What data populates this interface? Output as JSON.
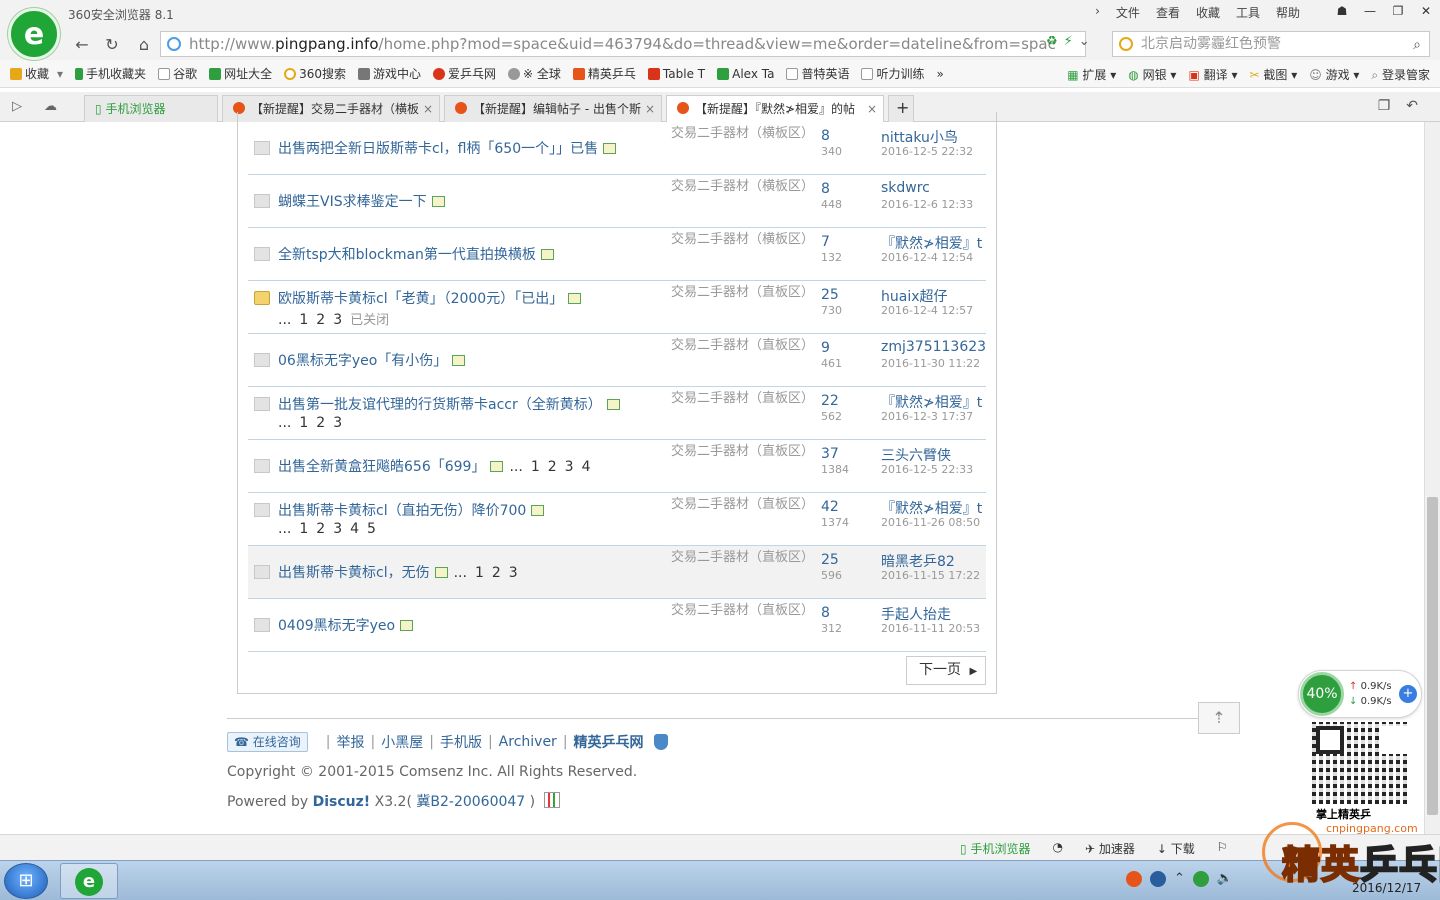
{
  "window": {
    "app_title": "360安全浏览器 8.1",
    "menu": [
      "文件",
      "查看",
      "收藏",
      "工具",
      "帮助"
    ],
    "controls": [
      "☗",
      "—",
      "❐",
      "✕"
    ]
  },
  "address_bar": {
    "url_prefix": "http://www.",
    "url_host": "pingpang.info",
    "url_rest": "/home.php?mod=space&uid=463794&do=thread&view=me&order=dateline&from=spac",
    "search_placeholder": "北京启动雾霾红色预警"
  },
  "favorites_bar": {
    "items": [
      {
        "label": "收藏",
        "color": "#e6a817"
      },
      {
        "label": "手机收藏夹",
        "color": "#2e9e3e"
      },
      {
        "label": "谷歌",
        "color": "#cccccc"
      },
      {
        "label": "网址大全",
        "color": "#2e9e3e"
      },
      {
        "label": "360搜索",
        "color": "#e6a817"
      },
      {
        "label": "游戏中心",
        "color": "#777777"
      },
      {
        "label": "爱乒乓网",
        "color": "#d9341a"
      },
      {
        "label": "※ 全球",
        "color": "#999999"
      },
      {
        "label": "精英乒乓",
        "color": "#e6541a"
      },
      {
        "label": "Table T",
        "color": "#d9341a"
      },
      {
        "label": "Alex Ta",
        "color": "#2e9e3e"
      },
      {
        "label": "普特英语",
        "color": "#cccccc"
      },
      {
        "label": "听力训练",
        "color": "#cccccc"
      }
    ],
    "right_items": [
      "扩展",
      "网银",
      "翻译",
      "截图",
      "游戏",
      "登录管家"
    ]
  },
  "tabs": [
    {
      "label": "手机浏览器",
      "active": false
    },
    {
      "label": "【新提醒】交易二手器材（横板",
      "active": false
    },
    {
      "label": "【新提醒】编辑帖子 - 出售个斯",
      "active": false
    },
    {
      "label": "【新提醒】『默然≯相爱』的帖",
      "active": true
    }
  ],
  "threads": [
    {
      "title": "出售两把全新日版斯蒂卡cl，fl柄「650一个」」已售",
      "pages": [],
      "inline_pages": [],
      "closed": "",
      "forum": "交易二手器材（横板区）",
      "replies": "8",
      "views": "340",
      "author": "nittaku小鸟",
      "date": "2016-12-5 22:32",
      "locked": false,
      "highlight": false
    },
    {
      "title": "蝴蝶王VIS求棒鉴定一下",
      "pages": [],
      "inline_pages": [],
      "closed": "",
      "forum": "交易二手器材（横板区）",
      "replies": "8",
      "views": "448",
      "author": "skdwrc",
      "date": "2016-12-6 12:33",
      "locked": false,
      "highlight": false
    },
    {
      "title": "全新tsp大和blockman第一代直拍换横板",
      "pages": [],
      "inline_pages": [],
      "closed": "",
      "forum": "交易二手器材（横板区）",
      "replies": "7",
      "views": "132",
      "author": "『默然≯相爱』t",
      "date": "2016-12-4 12:54",
      "locked": false,
      "highlight": false
    },
    {
      "title": "欧版斯蒂卡黄标cl「老黄」（2000元）「已出」",
      "pages": [
        "...",
        "1",
        "2",
        "3"
      ],
      "inline_pages": [],
      "closed": "已关闭",
      "forum": "交易二手器材（直板区）",
      "replies": "25",
      "views": "730",
      "author": "huaix超仔",
      "date": "2016-12-4 12:57",
      "locked": true,
      "highlight": false
    },
    {
      "title": "06黑标无字yeo「有小伤」",
      "pages": [],
      "inline_pages": [],
      "closed": "",
      "forum": "交易二手器材（直板区）",
      "replies": "9",
      "views": "461",
      "author": "zmj375113623",
      "date": "2016-11-30 11:22",
      "locked": false,
      "highlight": false
    },
    {
      "title": "出售第一批友谊代理的行货斯蒂卡accr（全新黄标）",
      "pages": [
        "...",
        "1",
        "2",
        "3"
      ],
      "inline_pages": [],
      "closed": "",
      "forum": "交易二手器材（直板区）",
      "replies": "22",
      "views": "562",
      "author": "『默然≯相爱』t",
      "date": "2016-12-3 17:37",
      "locked": false,
      "highlight": false
    },
    {
      "title": "出售全新黄盒狂飚皓656「699」",
      "pages": [],
      "inline_pages": [
        "...",
        "1",
        "2",
        "3",
        "4"
      ],
      "closed": "",
      "forum": "交易二手器材（直板区）",
      "replies": "37",
      "views": "1384",
      "author": "三头六臂侠",
      "date": "2016-12-5 22:33",
      "locked": false,
      "highlight": false
    },
    {
      "title": "出售斯蒂卡黄标cl（直拍无伤）降价700",
      "pages": [
        "...",
        "1",
        "2",
        "3",
        "4",
        "5"
      ],
      "inline_pages": [],
      "closed": "",
      "forum": "交易二手器材（直板区）",
      "replies": "42",
      "views": "1374",
      "author": "『默然≯相爱』t",
      "date": "2016-11-26 08:50",
      "locked": false,
      "highlight": false
    },
    {
      "title": "出售斯蒂卡黄标cl，无伤",
      "pages": [],
      "inline_pages": [
        "...",
        "1",
        "2",
        "3"
      ],
      "closed": "",
      "forum": "交易二手器材（直板区）",
      "replies": "25",
      "views": "596",
      "author": "暗黑老乒82",
      "date": "2016-11-15 17:22",
      "locked": false,
      "highlight": true
    },
    {
      "title": "0409黑标无字yeo",
      "pages": [],
      "inline_pages": [],
      "closed": "",
      "forum": "交易二手器材（直板区）",
      "replies": "8",
      "views": "312",
      "author": "手起人抬走",
      "date": "2016-11-11 20:53",
      "locked": false,
      "highlight": false
    }
  ],
  "pagination": {
    "next_label": "下一页"
  },
  "footer": {
    "consult_label": "在线咨询",
    "links": [
      "举报",
      "小黑屋",
      "手机版",
      "Archiver"
    ],
    "site_name": "精英乒乓网",
    "copyright": "Copyright © 2001-2015 Comsenz Inc.   All Rights Reserved.",
    "powered_prefix": "Powered by ",
    "powered_brand": "Discuz!",
    "powered_version": " X3.2( ",
    "license": "冀B2-20060047",
    "powered_suffix": " )"
  },
  "speed_widget": {
    "percent": "40%",
    "up": "0.9K/s",
    "down": "0.9K/s"
  },
  "qr_caption": "掌上精英乒",
  "status_bar": {
    "items": [
      "手机浏览器",
      "加速器",
      "下载"
    ]
  },
  "taskbar": {
    "clock": "2016/12/17"
  },
  "watermark": {
    "site": "cnpingpang.com",
    "brand_a": "精英",
    "brand_b": "乒乓网"
  }
}
